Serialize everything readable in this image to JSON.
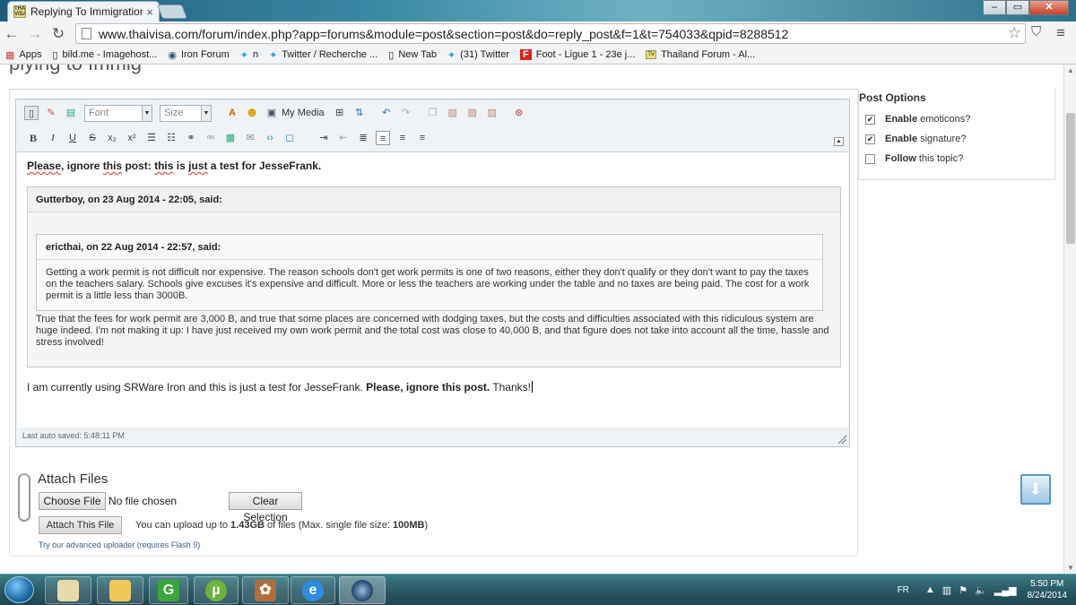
{
  "browser": {
    "tab_title": "Replying To Immigration I",
    "tab_close": "×",
    "url": "www.thaivisa.com/forum/index.php?app=forums&module=post&section=post&do=reply_post&f=1&t=754033&qpid=8288512",
    "favicon_text": "THAI VISA",
    "bookmarks": [
      {
        "label": "Apps",
        "icon": "apps-grid-icon"
      },
      {
        "label": "bild.me - Imagehost...",
        "icon": "page-icon"
      },
      {
        "label": "Iron Forum",
        "icon": "iron-icon"
      },
      {
        "label": "n",
        "icon": "twitter-bird-icon"
      },
      {
        "label": "Twitter / Recherche ...",
        "icon": "twitter-bird-icon"
      },
      {
        "label": "New Tab",
        "icon": "page-icon"
      },
      {
        "label": "(31) Twitter",
        "icon": "twitter-bird-icon"
      },
      {
        "label": "Foot - Ligue 1 - 23e j...",
        "icon": "foot-icon"
      },
      {
        "label": "Thailand Forum - Al...",
        "icon": "thaivisa-icon"
      }
    ]
  },
  "page": {
    "heading_fragment": "plying to Immig"
  },
  "editor": {
    "font_placeholder": "Font",
    "size_placeholder": "Size",
    "my_media_label": "My Media",
    "line1_parts": [
      "Please",
      ",",
      "ignore",
      "this",
      "post:",
      "this",
      "is",
      "just",
      "a test for",
      "JesseFrank",
      "."
    ],
    "quote_outer_cite": "Gutterboy, on 23 Aug 2014 - 22:05, said:",
    "quote_inner_cite": "ericthai, on 22 Aug 2014 - 22:57, said:",
    "quote_inner_text": "Getting a work permit is not difficult nor expensive. The reason schools don't get work permits is one of two reasons, either they don't qualify or they don't want to pay the taxes on the teachers salary. Schools give excuses it's expensive and difficult. More or less the teachers are working under the table and no taxes are being paid. The cost for a work permit is a little less than 3000B.",
    "quote_outer_text": "True that the fees for work permit are 3,000 B, and true that some places are concerned with dodging taxes, but the costs and difficulties associated with this ridiculous system are huge indeed. I'm not making it up: I have just received my own work permit and the total cost was close to 40,000 B, and that figure does not take into account all the time, hassle and stress involved!",
    "final_line_plain": "I am currently using SRWare Iron and this is just a test for JesseFrank.",
    "final_line_bold": "Please, ignore this post.",
    "final_line_end": "Thanks!",
    "autosave": "Last auto saved: 5:48:11 PM"
  },
  "attach": {
    "title": "Attach Files",
    "choose_file": "Choose File",
    "no_file": "No file chosen",
    "clear_selection": "Clear Selection",
    "attach_button": "Attach This File",
    "upload_prefix": "You can upload up to ",
    "upload_size": "1.43GB",
    "upload_middle": " of files (Max. single file size: ",
    "upload_max": "100MB",
    "upload_suffix": ")",
    "advanced_uploader": "Try our advanced uploader (requires Flash 9)"
  },
  "post_options": {
    "title": "Post Options",
    "items": [
      {
        "bold": "Enable",
        "rest": "emoticons?",
        "checked": true
      },
      {
        "bold": "Enable",
        "rest": "signature?",
        "checked": true
      },
      {
        "bold": "Follow",
        "rest": "this topic?",
        "checked": false
      }
    ]
  },
  "taskbar": {
    "language": "FR",
    "time": "5:50 PM",
    "date": "8/24/2014",
    "apps": [
      "file-explorer-icon",
      "folder-icon",
      "g-app-icon",
      "utorrent-icon",
      "rabbit-app-icon",
      "internet-explorer-icon",
      "srware-iron-icon"
    ]
  }
}
